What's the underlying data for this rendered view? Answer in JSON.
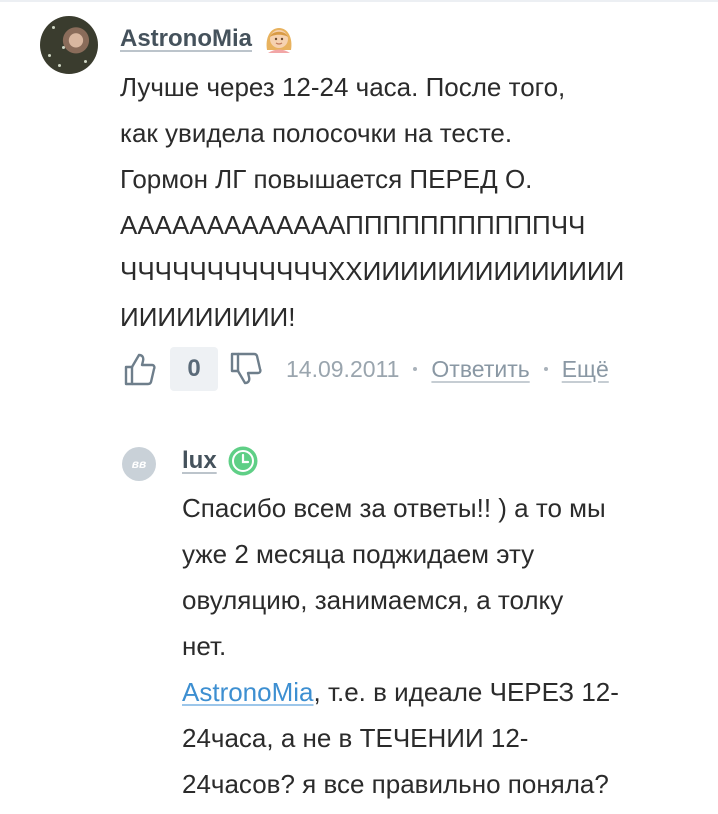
{
  "comment": {
    "author": "AstronoMia",
    "author_badge_icon": "girl-avatar-icon",
    "text_lines": [
      "Лучше через 12-24 часа. После того,",
      "как увидела полосочки на тесте.",
      "Гормон ЛГ повышается ПЕРЕД О.",
      "АААААААААААААПППППППППППЧЧ",
      "ЧЧЧЧЧЧЧЧЧЧЧЧХХИИИИИИИИИИИИИИ",
      "ИИИИИИИИИ!"
    ],
    "votes": "0",
    "date": "14.09.2011",
    "reply_label": "Ответить",
    "more_label": "Ещё"
  },
  "reply": {
    "avatar_text": "вв",
    "author": "lux",
    "status_icon": "clock-icon",
    "status_color": "#5fcf86",
    "text_lines": [
      "Спасибо всем за ответы!! ) а то мы",
      "уже 2 месяца поджидаем эту",
      "овуляцию, занимаемся, а толку",
      "нет."
    ],
    "mention": "AstronoMia",
    "mention_text_first": ", т.е. в идеале ЧЕРЕЗ 12-",
    "text_lines_after": [
      "24часа, а не в ТЕЧЕНИИ 12-",
      "24часов? я все правильно поняла?"
    ]
  },
  "colors": {
    "link": "#3d8fd1",
    "muted": "#9aa5ae",
    "author": "#45525c"
  }
}
